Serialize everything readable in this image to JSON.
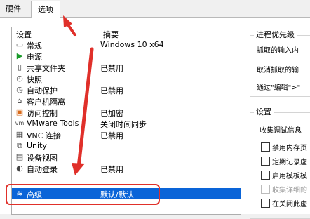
{
  "tabs": [
    {
      "label": "硬件"
    },
    {
      "label": "选项"
    }
  ],
  "list": {
    "col_settings": "设置",
    "col_summary": "摘要",
    "rows": [
      {
        "name": "常规",
        "summary": "Windows 10 x64",
        "icon": "general-icon"
      },
      {
        "name": "电源",
        "summary": "",
        "icon": "power-play-icon"
      },
      {
        "name": "共享文件夹",
        "summary": "已禁用",
        "icon": "shared-folder-icon"
      },
      {
        "name": "快照",
        "summary": "",
        "icon": "snapshot-icon"
      },
      {
        "name": "自动保护",
        "summary": "已禁用",
        "icon": "autoprotect-icon"
      },
      {
        "name": "客户机隔离",
        "summary": "",
        "icon": "lock-icon"
      },
      {
        "name": "访问控制",
        "summary": "已加密",
        "icon": "access-control-icon"
      },
      {
        "name": "VMware Tools",
        "summary": "关闭时间同步",
        "icon": "vmware-tools-icon"
      },
      {
        "name": "VNC 连接",
        "summary": "已禁用",
        "icon": "vnc-icon"
      },
      {
        "name": "Unity",
        "summary": "",
        "icon": "unity-icon"
      },
      {
        "name": "设备视图",
        "summary": "",
        "icon": "device-view-icon"
      },
      {
        "name": "自动登录",
        "summary": "已禁用",
        "icon": "autologin-icon"
      },
      {
        "name": "高级",
        "summary": "默认/默认",
        "icon": "advanced-icon"
      }
    ]
  },
  "right": {
    "priority_group": "进程优先级",
    "priority_line1": "抓取的输入内",
    "priority_line2": "取消抓取的输",
    "priority_line3": "通过\"编辑\">\"",
    "settings_group": "设置",
    "collect_label": "收集调试信息",
    "options": [
      {
        "label": "禁用内存页",
        "disabled": false
      },
      {
        "label": "定期记录虚",
        "disabled": false
      },
      {
        "label": "启用模板模",
        "disabled": false
      },
      {
        "label": "收集详细的",
        "disabled": true
      },
      {
        "label": "在关闭此虚",
        "disabled": false
      }
    ]
  },
  "annotation_color": "#e0302a",
  "selection_color": "#0a64d8"
}
